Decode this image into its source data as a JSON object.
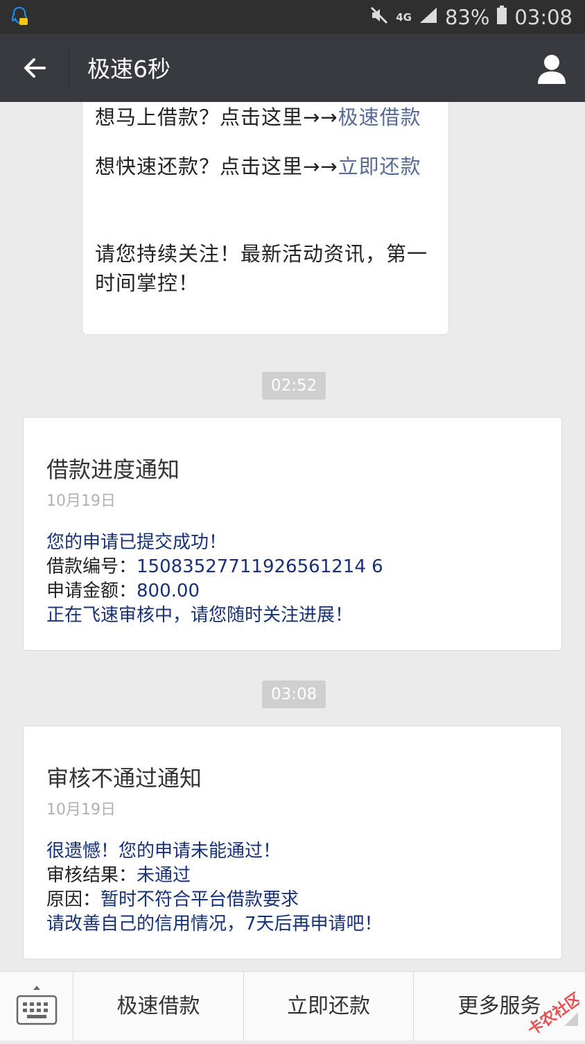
{
  "status_bar": {
    "network": "4G",
    "battery": "83%",
    "time": "03:08"
  },
  "nav": {
    "title": "极速6秒"
  },
  "bubble": {
    "line1_text": "想马上借款？点击这里→→",
    "line1_link": "极速借款",
    "line2_text": "想快速还款？点击这里→→",
    "line2_link": "立即还款",
    "line3_text": "请您持续关注！最新活动资讯，第一时间掌控！"
  },
  "timestamps": [
    "02:52",
    "03:08"
  ],
  "card1": {
    "title": "借款进度通知",
    "date": "10月19日",
    "first": "您的申请已提交成功！",
    "field1_label": "借款编号：",
    "field1_value": "15083527711926561214 6",
    "field2_label": "申请金额：",
    "field2_value": "800.00",
    "remark": "正在飞速审核中，请您随时关注进展！"
  },
  "card2": {
    "title": "审核不通过通知",
    "date": "10月19日",
    "first": "很遗憾！您的申请未能通过！",
    "field1_label": "审核结果：",
    "field1_value": "未通过",
    "field2_label": "原因：",
    "field2_value": "暂时不符合平台借款要求",
    "remark": "请改善自己的信用情况，7天后再申请吧！"
  },
  "menu": {
    "items": [
      "极速借款",
      "立即还款",
      "更多服务"
    ]
  },
  "watermark": {
    "text": "卡农社区"
  },
  "colors": {
    "nav_bg": "#393a3f",
    "link": "#576b95",
    "template_blue": "#173177",
    "page_bg": "#ebebeb"
  }
}
